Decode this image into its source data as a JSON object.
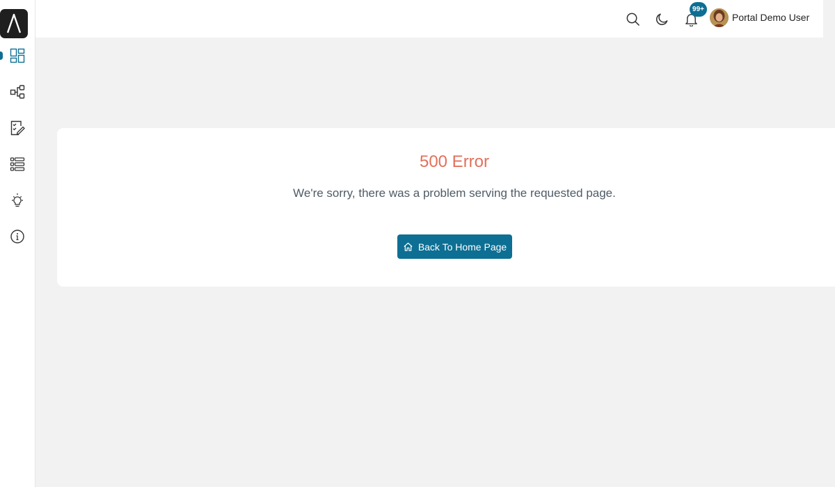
{
  "header": {
    "notification_count": "99+",
    "user_name": "Portal Demo User"
  },
  "sidebar": {
    "items": [
      {
        "icon": "dashboard-icon",
        "active": true
      },
      {
        "icon": "workflow-icon",
        "active": false
      },
      {
        "icon": "forms-icon",
        "active": false
      },
      {
        "icon": "list-icon",
        "active": false
      },
      {
        "icon": "lightbulb-icon",
        "active": false
      },
      {
        "icon": "info-icon",
        "active": false
      }
    ]
  },
  "error": {
    "title": "500 Error",
    "message": "We're sorry, there was a problem serving the requested page.",
    "button_label": "Back To Home Page"
  },
  "colors": {
    "accent": "#0d6f93",
    "error": "#e2705c"
  }
}
